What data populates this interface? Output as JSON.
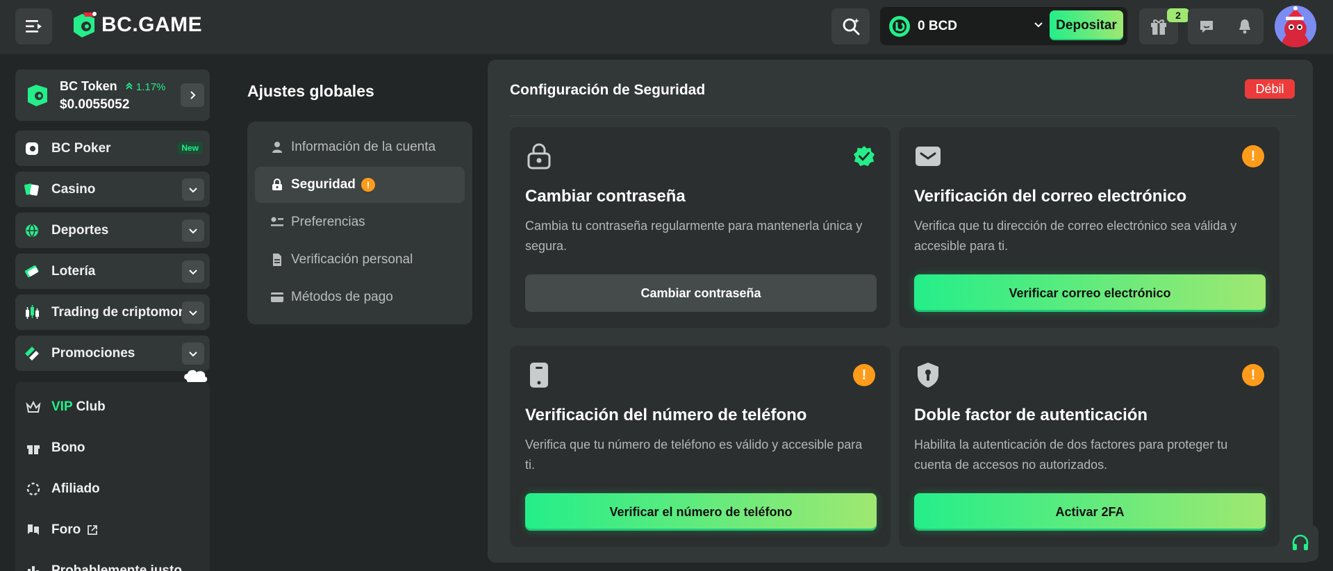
{
  "header": {
    "logo_text": "BC.GAME",
    "wallet_amount": "0 BCD",
    "deposit_label": "Depositar",
    "gift_count": "2"
  },
  "sidebar": {
    "token": {
      "name": "BC Token",
      "change": "1.17%",
      "price": "$0.0055052"
    },
    "items": [
      {
        "label": "BC Poker",
        "badge": "New",
        "icon": "poker-icon"
      },
      {
        "label": "Casino",
        "icon": "casino-icon"
      },
      {
        "label": "Deportes",
        "icon": "sports-ball-icon"
      },
      {
        "label": "Lotería",
        "icon": "lottery-icon"
      },
      {
        "label": "Trading de criptomonedas",
        "icon": "candlestick-icon"
      },
      {
        "label": "Promociones",
        "icon": "promo-icon"
      }
    ],
    "sub_items": [
      {
        "label_accent": "VIP",
        "label": "Club",
        "icon": "crown-icon"
      },
      {
        "label": "Bono",
        "icon": "gift-icon"
      },
      {
        "label": "Afiliado",
        "icon": "affiliate-icon"
      },
      {
        "label": "Foro",
        "icon": "forum-icon"
      },
      {
        "label": "Probablemente justo",
        "icon": "fair-icon"
      }
    ]
  },
  "settings": {
    "title": "Ajustes globales",
    "items": [
      {
        "label": "Información de la cuenta",
        "icon": "user-icon"
      },
      {
        "label": "Seguridad",
        "icon": "lock-icon",
        "active": true,
        "warning": "!"
      },
      {
        "label": "Preferencias",
        "icon": "preferences-icon"
      },
      {
        "label": "Verificación personal",
        "icon": "document-icon"
      },
      {
        "label": "Métodos de pago",
        "icon": "card-icon"
      }
    ]
  },
  "security": {
    "title": "Configuración de Seguridad",
    "strength": "Débil",
    "cards": [
      {
        "title": "Cambiar contraseña",
        "description": "Cambia tu contraseña regularmente para mantenerla única y segura.",
        "button": "Cambiar contraseña",
        "status": "verified",
        "icon": "padlock-icon"
      },
      {
        "title": "Verificación del correo electrónico",
        "description": "Verifica que tu dirección de correo electrónico sea válida y accesible para ti.",
        "button": "Verificar correo electrónico",
        "status": "warning",
        "icon": "envelope-icon"
      },
      {
        "title": "Verificación del número de teléfono",
        "description": "Verifica que tu número de teléfono es válido y accesible para ti.",
        "button": "Verificar el número de teléfono",
        "status": "warning",
        "icon": "phone-icon"
      },
      {
        "title": "Doble factor de autenticación",
        "description": "Habilita la autenticación de dos factores para proteger tu cuenta de accesos no autorizados.",
        "button": "Activar 2FA",
        "status": "warning",
        "icon": "shield-key-icon"
      }
    ],
    "warning_mark": "!"
  },
  "colors": {
    "accent": "#24ee89",
    "accent2": "#9fe871",
    "warning": "#ff9b1a",
    "danger": "#ed3b3b",
    "panel": "#323738",
    "background": "#232626"
  }
}
